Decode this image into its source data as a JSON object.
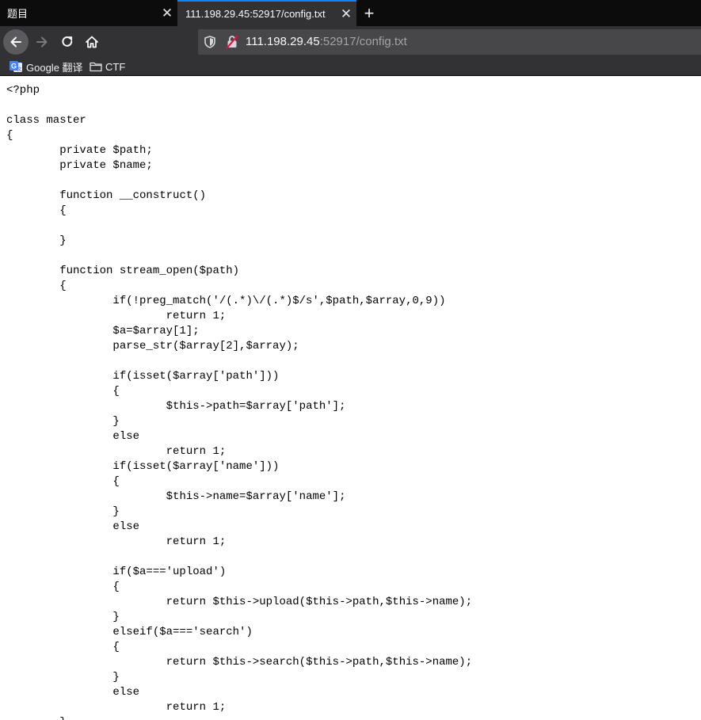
{
  "tabs": [
    {
      "title": "题目",
      "active": false,
      "close": "✕"
    },
    {
      "title": "111.198.29.45:52917/config.txt",
      "active": true,
      "close": "✕"
    }
  ],
  "new_tab_label": "+",
  "nav": {
    "back_icon": "arrow-left-icon",
    "forward_icon": "arrow-right-icon",
    "reload_icon": "reload-icon",
    "home_icon": "home-icon"
  },
  "urlbar": {
    "host": "111.198.29.45",
    "rest": ":52917/config.txt"
  },
  "bookmarks": [
    {
      "label": "Google 翻译",
      "icon": "google-translate-icon"
    },
    {
      "label": "CTF",
      "icon": "folder-icon"
    }
  ],
  "colors": {
    "chrome_dark": "#0c0c0d",
    "toolbar": "#323234",
    "urlbar": "#474749",
    "active_tab_accent": "#0a84ff",
    "page_bg": "#ffffff"
  },
  "page": {
    "code": "<?php\n\nclass master\n{\n\tprivate $path;\n\tprivate $name;\n\n\tfunction __construct()\n\t{\n\n\t}\n\n\tfunction stream_open($path)\n\t{\n\t\tif(!preg_match('/(.*)\\/(.*)$/s',$path,$array,0,9))\n\t\t\treturn 1;\n\t\t$a=$array[1];\n\t\tparse_str($array[2],$array);\n\n\t\tif(isset($array['path']))\n\t\t{\n\t\t\t$this->path=$array['path'];\n\t\t}\n\t\telse\n\t\t\treturn 1;\n\t\tif(isset($array['name']))\n\t\t{\n\t\t\t$this->name=$array['name'];\n\t\t}\n\t\telse\n\t\t\treturn 1;\n\n\t\tif($a==='upload')\n\t\t{\n\t\t\treturn $this->upload($this->path,$this->name);\n\t\t}\n\t\telseif($a==='search')\n\t\t{\n\t\t\treturn $this->search($this->path,$this->name);\n\t\t}\n\t\telse\n\t\t\treturn 1;\n\t}"
  }
}
